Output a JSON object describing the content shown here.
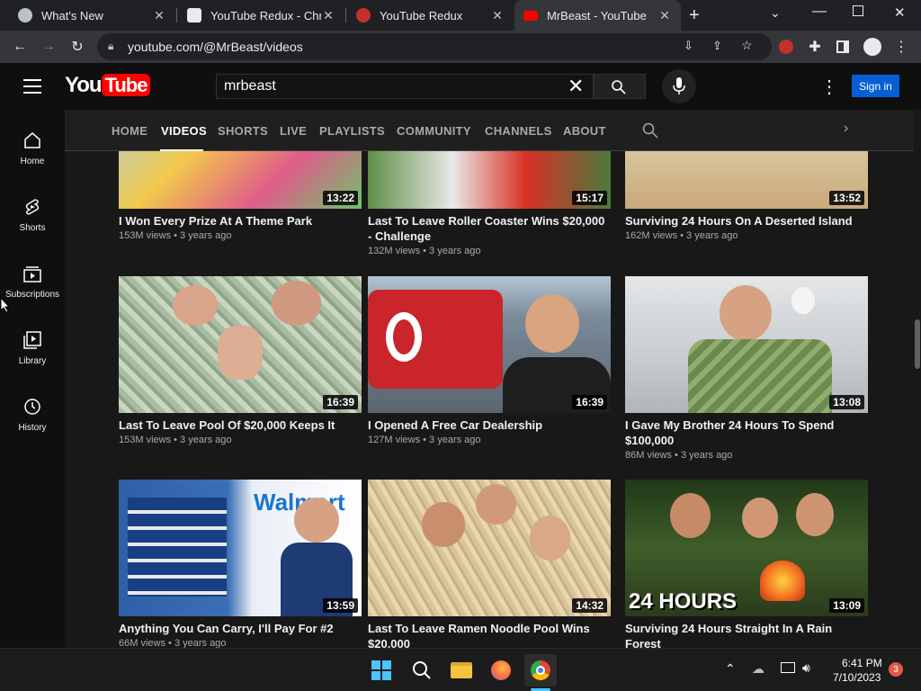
{
  "browser": {
    "tabs": [
      {
        "label": "What's New",
        "icon": "chrome-icon",
        "active": false
      },
      {
        "label": "YouTube Redux - Chror",
        "icon": "webstore-icon",
        "active": false
      },
      {
        "label": "YouTube Redux",
        "icon": "redux-extension-icon",
        "active": false
      },
      {
        "label": "MrBeast - YouTube",
        "icon": "youtube-icon",
        "active": true
      }
    ],
    "new_tab_symbol": "+",
    "url": "youtube.com/@MrBeast/videos"
  },
  "youtube": {
    "logo_text": "YouTube",
    "search_value": "mrbeast",
    "signin_label": "Sign in",
    "guide": [
      {
        "label": "Home",
        "icon": "home-icon"
      },
      {
        "label": "Shorts",
        "icon": "shorts-icon"
      },
      {
        "label": "Subscriptions",
        "icon": "subscriptions-icon"
      },
      {
        "label": "Library",
        "icon": "library-icon"
      },
      {
        "label": "History",
        "icon": "history-icon"
      }
    ],
    "channel_tabs": [
      {
        "label": "HOME",
        "active": false
      },
      {
        "label": "VIDEOS",
        "active": true
      },
      {
        "label": "SHORTS",
        "active": false
      },
      {
        "label": "LIVE",
        "active": false
      },
      {
        "label": "PLAYLISTS",
        "active": false
      },
      {
        "label": "COMMUNITY",
        "active": false
      },
      {
        "label": "CHANNELS",
        "active": false
      },
      {
        "label": "ABOUT",
        "active": false
      }
    ],
    "videos": [
      {
        "title": "I Won Every Prize At A Theme Park",
        "views": "153M views",
        "age": "3 years ago",
        "duration": "13:22",
        "thumb_color": "#7fb6d8"
      },
      {
        "title": "Last To Leave Roller Coaster Wins $20,000 - Challenge",
        "views": "132M views",
        "age": "3 years ago",
        "duration": "15:17",
        "thumb_color": "#4a7a3c"
      },
      {
        "title": "Surviving 24 Hours On A Deserted Island",
        "views": "162M views",
        "age": "3 years ago",
        "duration": "13:52",
        "thumb_color": "#c9a97a"
      },
      {
        "title": "Last To Leave Pool Of $20,000 Keeps It",
        "views": "153M views",
        "age": "3 years ago",
        "duration": "16:39",
        "thumb_color": "#9fb09a"
      },
      {
        "title": "I Opened A Free Car Dealership",
        "views": "127M views",
        "age": "3 years ago",
        "duration": "16:39",
        "thumb_color": "#b83030"
      },
      {
        "title": "I Gave My Brother 24 Hours To Spend $100,000",
        "views": "86M views",
        "age": "3 years ago",
        "duration": "13:08",
        "thumb_color": "#6d8a5c"
      },
      {
        "title": "Anything You Can Carry, I'll Pay For #2",
        "views": "66M views",
        "age": "3 years ago",
        "duration": "13:59",
        "thumb_color": "#3b6fb5"
      },
      {
        "title": "Last To Leave Ramen Noodle Pool Wins $20,000",
        "views": "",
        "age": "",
        "duration": "14:32",
        "thumb_color": "#d6c29a"
      },
      {
        "title": "Surviving 24 Hours Straight In A Rain Forest",
        "views": "",
        "age": "",
        "duration": "13:09",
        "thumb_color": "#3f5e2a",
        "overlay_text": "24 HOURS"
      }
    ]
  },
  "taskbar": {
    "time": "6:41 PM",
    "date": "7/10/2023",
    "notification_count": "3"
  }
}
